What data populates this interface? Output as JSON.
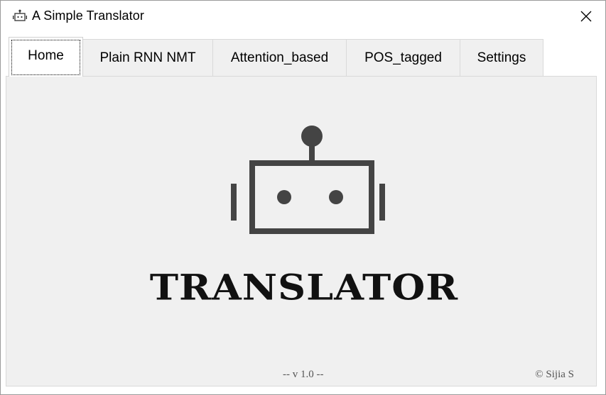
{
  "window": {
    "title": "A Simple Translator",
    "icon": "robot-icon",
    "close_icon": "close-icon"
  },
  "tabs": [
    {
      "label": "Home",
      "active": true
    },
    {
      "label": "Plain RNN NMT",
      "active": false
    },
    {
      "label": "Attention_based",
      "active": false
    },
    {
      "label": "POS_tagged",
      "active": false
    },
    {
      "label": "Settings",
      "active": false
    }
  ],
  "home": {
    "logo_icon": "robot-icon",
    "logo_text": "TRANSLATOR",
    "version": "-- v 1.0 --",
    "copyright": "© Sijia S"
  },
  "colors": {
    "robot": "#444444",
    "panel_bg": "#f0f0f0",
    "logo_text": "#111111"
  }
}
